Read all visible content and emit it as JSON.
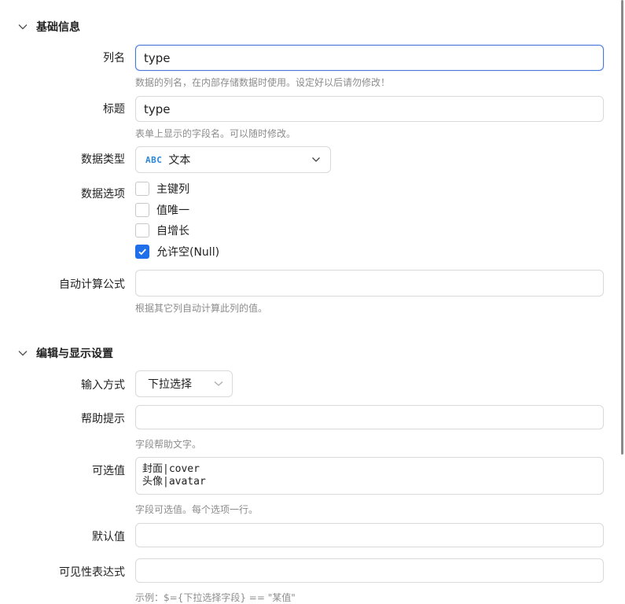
{
  "basic": {
    "title": "基础信息",
    "column_name": {
      "label": "列名",
      "value": "type",
      "hint": "数据的列名，在内部存储数据时使用。设定好以后请勿修改！"
    },
    "caption": {
      "label": "标题",
      "value": "type",
      "hint": "表单上显示的字段名。可以随时修改。"
    },
    "data_type": {
      "label": "数据类型",
      "icon": "ABC",
      "value": "文本"
    },
    "data_options": {
      "label": "数据选项",
      "items": [
        {
          "label": "主键列",
          "checked": false
        },
        {
          "label": "值唯一",
          "checked": false
        },
        {
          "label": "自增长",
          "checked": false
        },
        {
          "label": "允许空(Null)",
          "checked": true
        }
      ]
    },
    "formula": {
      "label": "自动计算公式",
      "value": "",
      "hint": "根据其它列自动计算此列的值。"
    }
  },
  "display": {
    "title": "编辑与显示设置",
    "input_mode": {
      "label": "输入方式",
      "value": "下拉选择"
    },
    "help_text": {
      "label": "帮助提示",
      "value": "",
      "hint": "字段帮助文字。"
    },
    "options": {
      "label": "可选值",
      "lines": [
        "封面|cover",
        "头像|avatar"
      ],
      "hint": "字段可选值。每个选项一行。"
    },
    "default_value": {
      "label": "默认值",
      "value": ""
    },
    "visibility_expr": {
      "label": "可见性表达式",
      "value": "",
      "hint": "示例：$={下拉选择字段} == \"某值\""
    }
  },
  "colors": {
    "accent": "#1f6feb",
    "focus_border": "#4a78d9",
    "hint_text": "#8c8c8c"
  }
}
